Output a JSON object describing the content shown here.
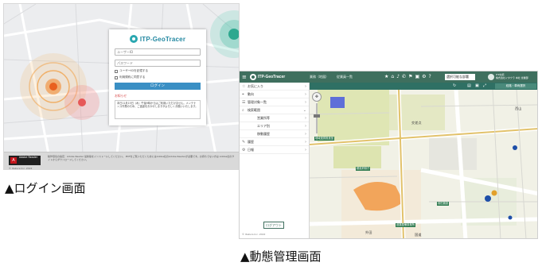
{
  "captions": {
    "login": "▲ログイン画面",
    "management": "▲動態管理画面"
  },
  "login_screen": {
    "app_name": "ITP-GeoTracer",
    "user_id_placeholder": "ユーザーID",
    "password_placeholder": "パスワード",
    "remember_label": "ユーザーIDを記憶する",
    "agree_label": "利用規約に同意する",
    "login_button": "ログイン",
    "notice_title": "お知らせ",
    "notice_text": "本日11月15日（木）午後9時からはご利用いただけません。メンテナンス作業のため、ご迷惑をおかけしますがよろしくお願いいたします。",
    "adobe_name": "Adobe Reader",
    "footer_text": "動作環境の指定：Adobe Reader 最新版をインストールしてください。 PDFをご覧いただくためにはAdobe社のAdobe Readerが必要です。お持ちでない方は Adobe社のサイトからダウンロードしてください。",
    "copyright": "© Itakura Inc. 2022"
  },
  "management_screen": {
    "app_name": "ITP-GeoTracer",
    "top_tabs": [
      "業務（地図）",
      "従業員一覧"
    ],
    "top_icons": [
      "star-icon",
      "home-icon",
      "bell-icon",
      "phone-icon",
      "flag-icon",
      "printer-icon",
      "gear-icon",
      "help-icon"
    ],
    "group_select": "選択可能な部署",
    "user_name": "ITP太郎",
    "user_info": "株式会社イタクラ 本社 営業部",
    "sidebar": [
      {
        "label": "お気に入り",
        "icon": "star-icon",
        "level": 0
      },
      {
        "label": "動向",
        "icon": "pin-icon",
        "level": 0
      },
      {
        "label": "管理対象一覧",
        "icon": "list-icon",
        "level": 0
      },
      {
        "label": "検索範囲",
        "icon": "search-icon",
        "level": 0
      },
      {
        "label": "営業所等",
        "icon": "",
        "level": 1
      },
      {
        "label": "エリア別",
        "icon": "",
        "level": 1
      },
      {
        "label": "移動履歴",
        "icon": "",
        "level": 1
      },
      {
        "label": "履歴",
        "icon": "pen-icon",
        "level": 0
      },
      {
        "label": "日報",
        "icon": "gear-icon",
        "level": 0
      }
    ],
    "logout_button": "ログアウト",
    "copyright": "© Itakura Inc. 2022",
    "map_button": "経路・車両選択",
    "map_labels": [
      {
        "text": "地域連携推進室",
        "kind": "tag"
      },
      {
        "text": "都道府県庁",
        "kind": "tag"
      },
      {
        "text": "前田施設",
        "kind": "tag"
      },
      {
        "text": "道路整備事務所",
        "kind": "tag"
      },
      {
        "text": "交差点",
        "kind": "text"
      },
      {
        "text": "外田",
        "kind": "text"
      },
      {
        "text": "西山",
        "kind": "text"
      },
      {
        "text": "国道",
        "kind": "text"
      }
    ]
  }
}
